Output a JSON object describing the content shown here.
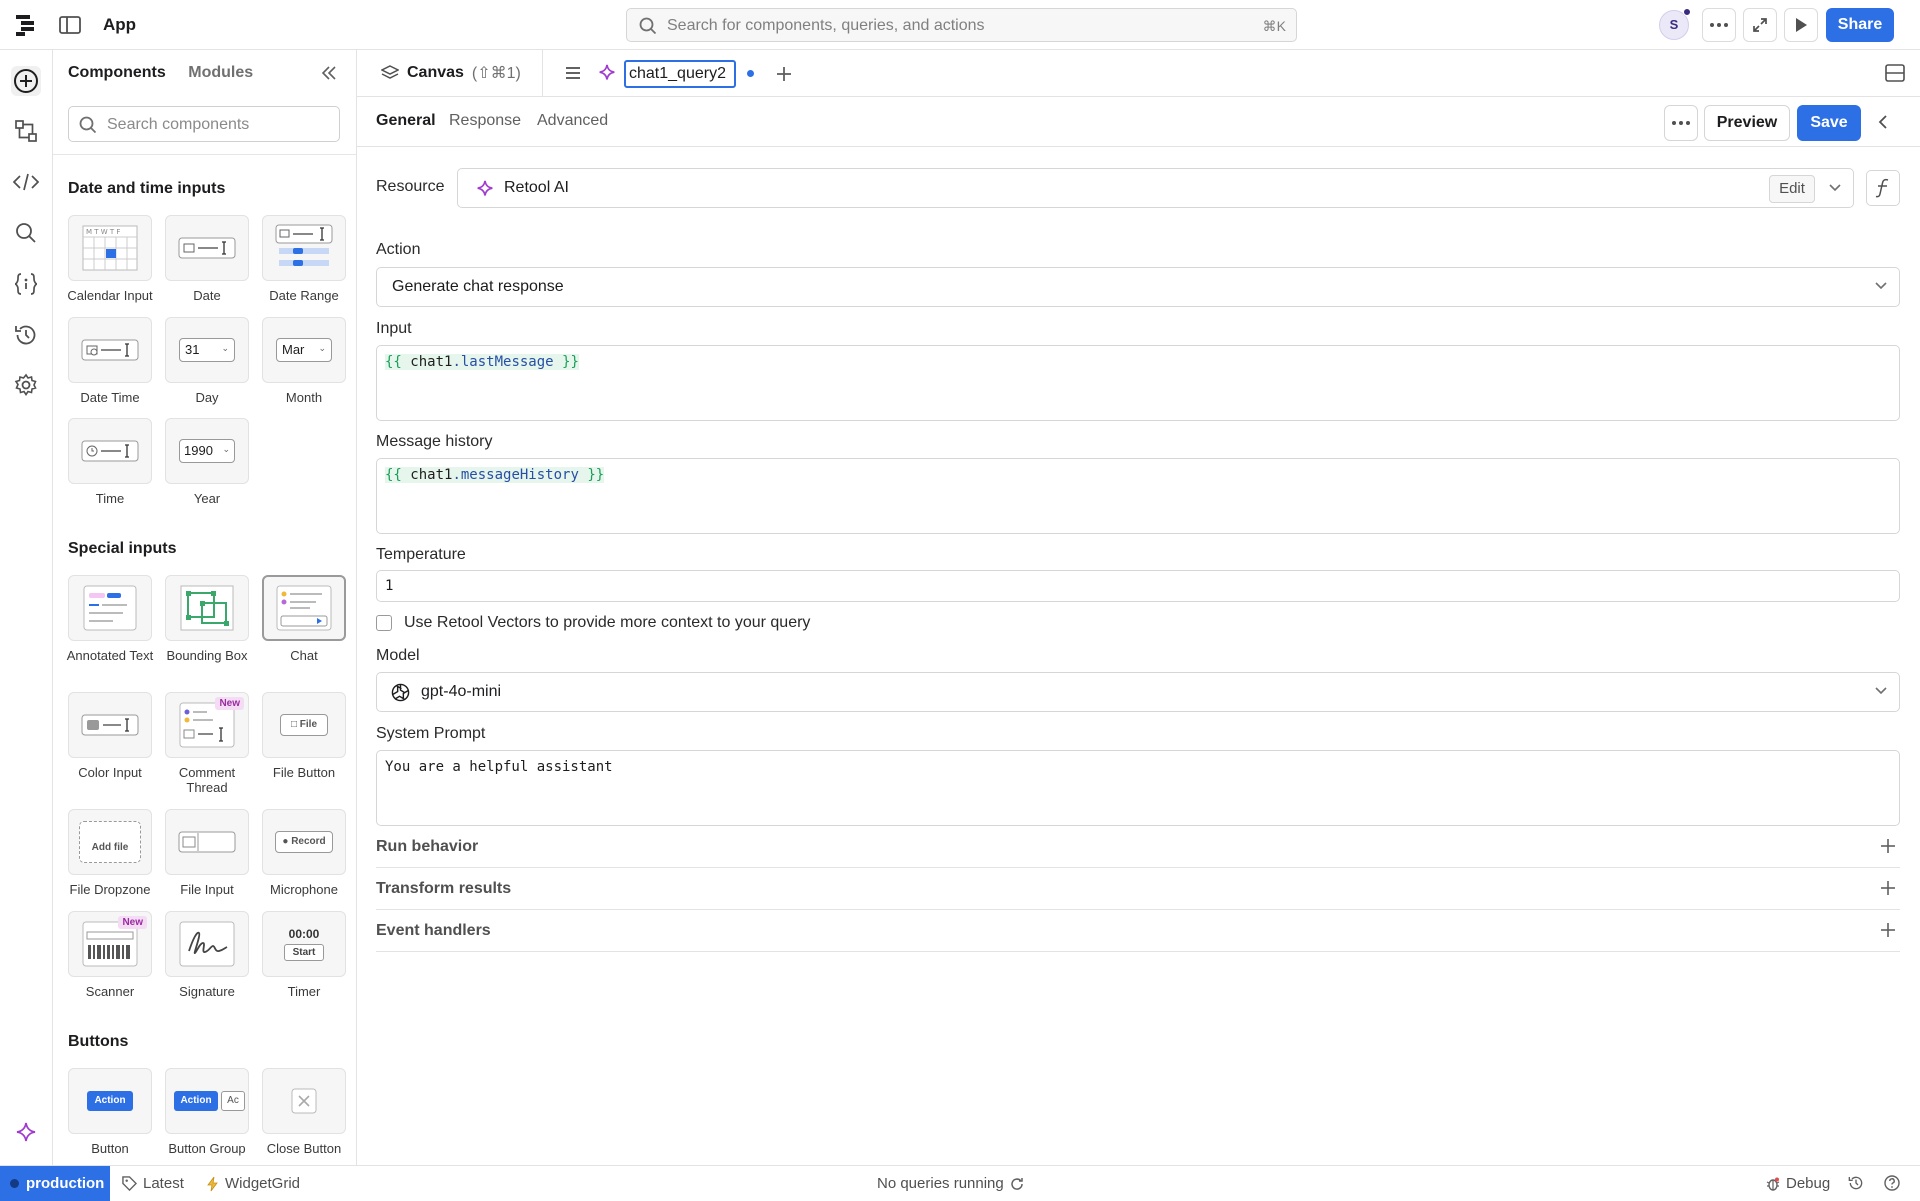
{
  "app": {
    "title": "App"
  },
  "topbar": {
    "search_placeholder": "Search for components, queries, and actions",
    "search_shortcut": "⌘K",
    "avatar_initial": "S",
    "share_label": "Share"
  },
  "components_panel": {
    "tab_components": "Components",
    "tab_modules": "Modules",
    "search_placeholder": "Search components",
    "sections": {
      "date_time": "Date and time inputs",
      "special": "Special inputs",
      "buttons": "Buttons"
    },
    "tiles": {
      "calendar_input": "Calendar Input",
      "date": "Date",
      "date_range": "Date Range",
      "date_time": "Date Time",
      "day": "Day",
      "day_value": "31",
      "month": "Month",
      "month_value": "Mar",
      "time": "Time",
      "year": "Year",
      "year_value": "1990",
      "annotated_text": "Annotated Text",
      "bounding_box": "Bounding Box",
      "chat": "Chat",
      "color_input": "Color Input",
      "comment_thread": "Comment Thread",
      "file_button": "File Button",
      "file_button_inner": "File",
      "file_dropzone": "File Dropzone",
      "file_dropzone_inner": "Add file",
      "file_input": "File Input",
      "microphone": "Microphone",
      "microphone_inner": "Record",
      "scanner": "Scanner",
      "signature": "Signature",
      "timer": "Timer",
      "timer_time": "00:00",
      "timer_start": "Start",
      "button": "Button",
      "button_inner": "Action",
      "button_group": "Button Group",
      "button_group_inner": "Action",
      "close_button": "Close Button",
      "new_badge": "New"
    }
  },
  "tabstrip": {
    "canvas_label": "Canvas",
    "canvas_shortcut": "(⇧⌘1)",
    "query_name": "chat1_query2"
  },
  "query_tabs": {
    "general": "General",
    "response": "Response",
    "advanced": "Advanced",
    "preview": "Preview",
    "save": "Save"
  },
  "form": {
    "resource_label": "Resource",
    "resource_value": "Retool AI",
    "edit_label": "Edit",
    "action_label": "Action",
    "action_value": "Generate chat response",
    "input_label": "Input",
    "input_obj": "chat1",
    "input_prop": ".lastMessage",
    "history_label": "Message history",
    "history_obj": "chat1",
    "history_prop": ".messageHistory",
    "open_braces": "{{",
    "close_braces": "}}",
    "temperature_label": "Temperature",
    "temperature_value": "1",
    "vectors_label": "Use Retool Vectors to provide more context to your query",
    "model_label": "Model",
    "model_value": "gpt-4o-mini",
    "system_prompt_label": "System Prompt",
    "system_prompt_value": "You are a helpful assistant",
    "run_behavior": "Run behavior",
    "transform_results": "Transform results",
    "event_handlers": "Event handlers"
  },
  "statusbar": {
    "env": "production",
    "version": "Latest",
    "branch": "WidgetGrid",
    "queries": "No queries running",
    "debug": "Debug"
  },
  "colors": {
    "accent": "#2d6fe5",
    "ai_purple": "#a03bd0"
  }
}
